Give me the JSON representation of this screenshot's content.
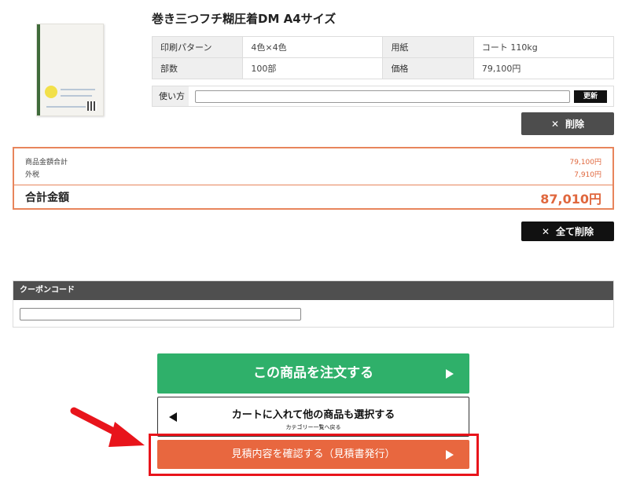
{
  "product": {
    "title": "巻き三つフチ糊圧着DM A4サイズ",
    "specs": [
      {
        "label1": "印刷パターン",
        "value1": "4色×4色",
        "label2": "用紙",
        "value2": "コート 110kg"
      },
      {
        "label1": "部数",
        "value1": "100部",
        "label2": "価格",
        "value2": "79,100円"
      }
    ],
    "usage_label": "使い方",
    "usage_value": "",
    "update_label": "更新",
    "delete_label": "削除"
  },
  "summary": {
    "subtotal_label": "商品金額合計",
    "subtotal_value": "79,100円",
    "tax_label": "外税",
    "tax_value": "7,910円",
    "total_label": "合計金額",
    "total_value": "87,010円"
  },
  "delete_all_label": "全て削除",
  "coupon": {
    "header": "クーポンコード",
    "value": ""
  },
  "actions": {
    "order_label": "この商品を注文する",
    "cart_label": "カートに入れて他の商品も選択する",
    "cart_sub": "カテゴリー一覧へ戻る",
    "quote_label": "見積内容を確認する（見積書発行）"
  },
  "colors": {
    "order_green": "#2fb06a",
    "quote_orange": "#e8673f",
    "highlight_red": "#e8141b",
    "price_orange": "#e0673d"
  }
}
